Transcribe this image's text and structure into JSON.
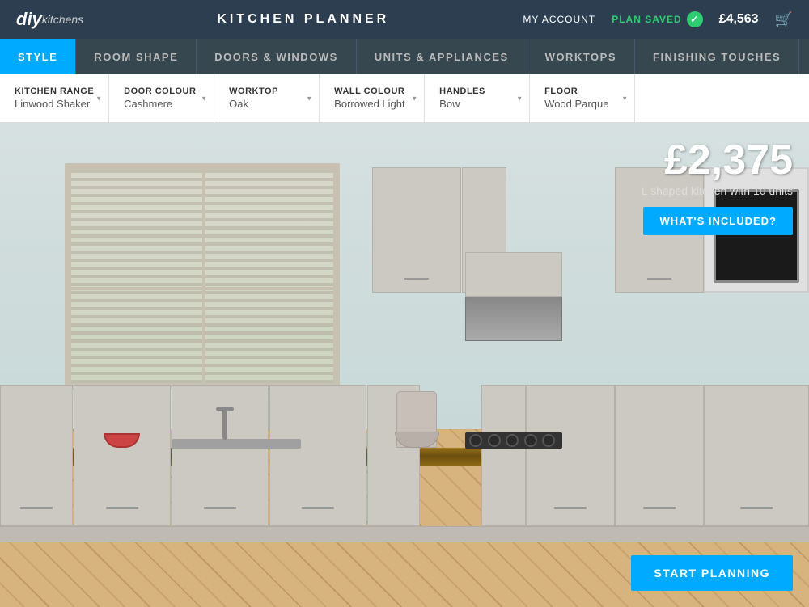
{
  "header": {
    "logo_diy": "diy",
    "logo_kitchens": "kitchens",
    "title": "KITCHEN PLANNER",
    "my_account": "MY ACCOUNT",
    "plan_saved": "PLAN SAVED",
    "price": "£4,563",
    "cart_icon": "🛒"
  },
  "tabs": [
    {
      "id": "style",
      "label": "STYLE",
      "active": true
    },
    {
      "id": "room-shape",
      "label": "ROOM SHAPE",
      "active": false
    },
    {
      "id": "doors-windows",
      "label": "DOORS & WINDOWS",
      "active": false
    },
    {
      "id": "units-appliances",
      "label": "UNITS & APPLIANCES",
      "active": false
    },
    {
      "id": "worktops",
      "label": "WORKTOPS",
      "active": false
    },
    {
      "id": "finishing-touches",
      "label": "FINISHING TOUCHES",
      "active": false
    }
  ],
  "options": [
    {
      "id": "kitchen-range",
      "label": "KITCHEN RANGE",
      "value": "Linwood Shaker"
    },
    {
      "id": "door-colour",
      "label": "DOOR COLOUR",
      "value": "Cashmere"
    },
    {
      "id": "worktop",
      "label": "WORKTOP",
      "value": "Oak"
    },
    {
      "id": "wall-colour",
      "label": "WALL COLOUR",
      "value": "Borrowed Light"
    },
    {
      "id": "handles",
      "label": "HANDLES",
      "value": "Bow"
    },
    {
      "id": "floor",
      "label": "FLOOR",
      "value": "Wood Parque"
    }
  ],
  "main": {
    "price": "£2,375",
    "description": "L shaped kitchen with 10 units",
    "whats_included": "WHAT'S INCLUDED?",
    "start_planning": "START PLANNING"
  },
  "colors": {
    "accent": "#00aaff",
    "nav_bg": "#2c3e50",
    "tabs_bg": "#37474f",
    "active_tab": "#00aaff",
    "plan_saved": "#2ecc71",
    "cabinet": "#ccc9c2",
    "worktop": "#8B6914"
  }
}
